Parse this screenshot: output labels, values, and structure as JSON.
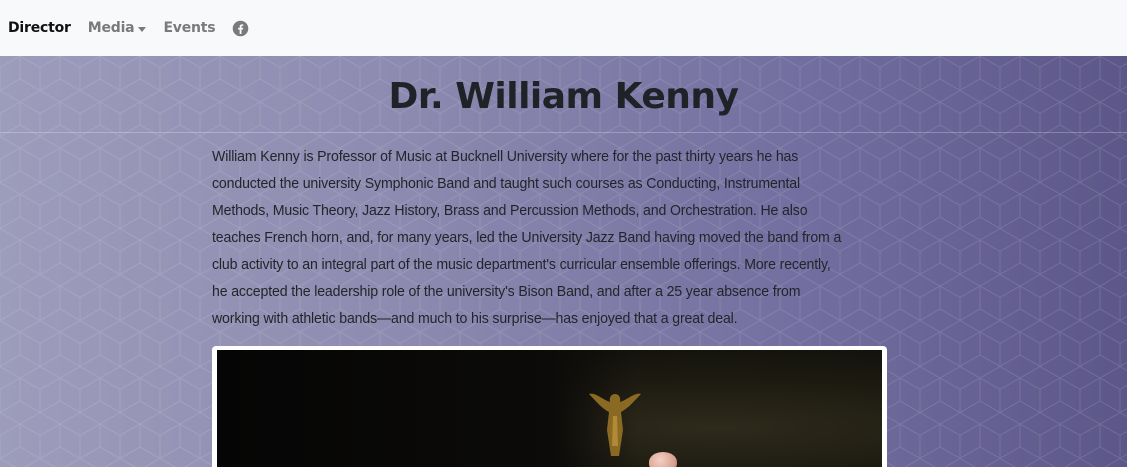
{
  "nav": {
    "items": [
      {
        "label": "Director",
        "active": true
      },
      {
        "label": "Media",
        "dropdown": true
      },
      {
        "label": "Events"
      }
    ],
    "social_icon": "facebook-icon"
  },
  "main": {
    "title": "Dr. William Kenny",
    "bio": "William Kenny is Professor of Music at Bucknell University where for the past thirty years he has conducted the university Symphonic Band and taught such courses as Conducting, Instrumental Methods, Music Theory, Jazz History, Brass and Percussion Methods, and Orchestration. He also teaches French horn, and, for many years, led the University Jazz Band having moved the band from a club activity to an integral part of the music department's curricular ensemble offerings. More recently, he accepted the leadership role of the university's Bison Band, and after a 25 year absence from working with athletic bands—and much to his surprise—has enjoyed that a great deal."
  },
  "colors": {
    "background_gradient_start": "#9d9cbb",
    "background_gradient_end": "#5c5788",
    "title_color": "#1f2226",
    "navbar_bg": "#f8f9fa"
  }
}
